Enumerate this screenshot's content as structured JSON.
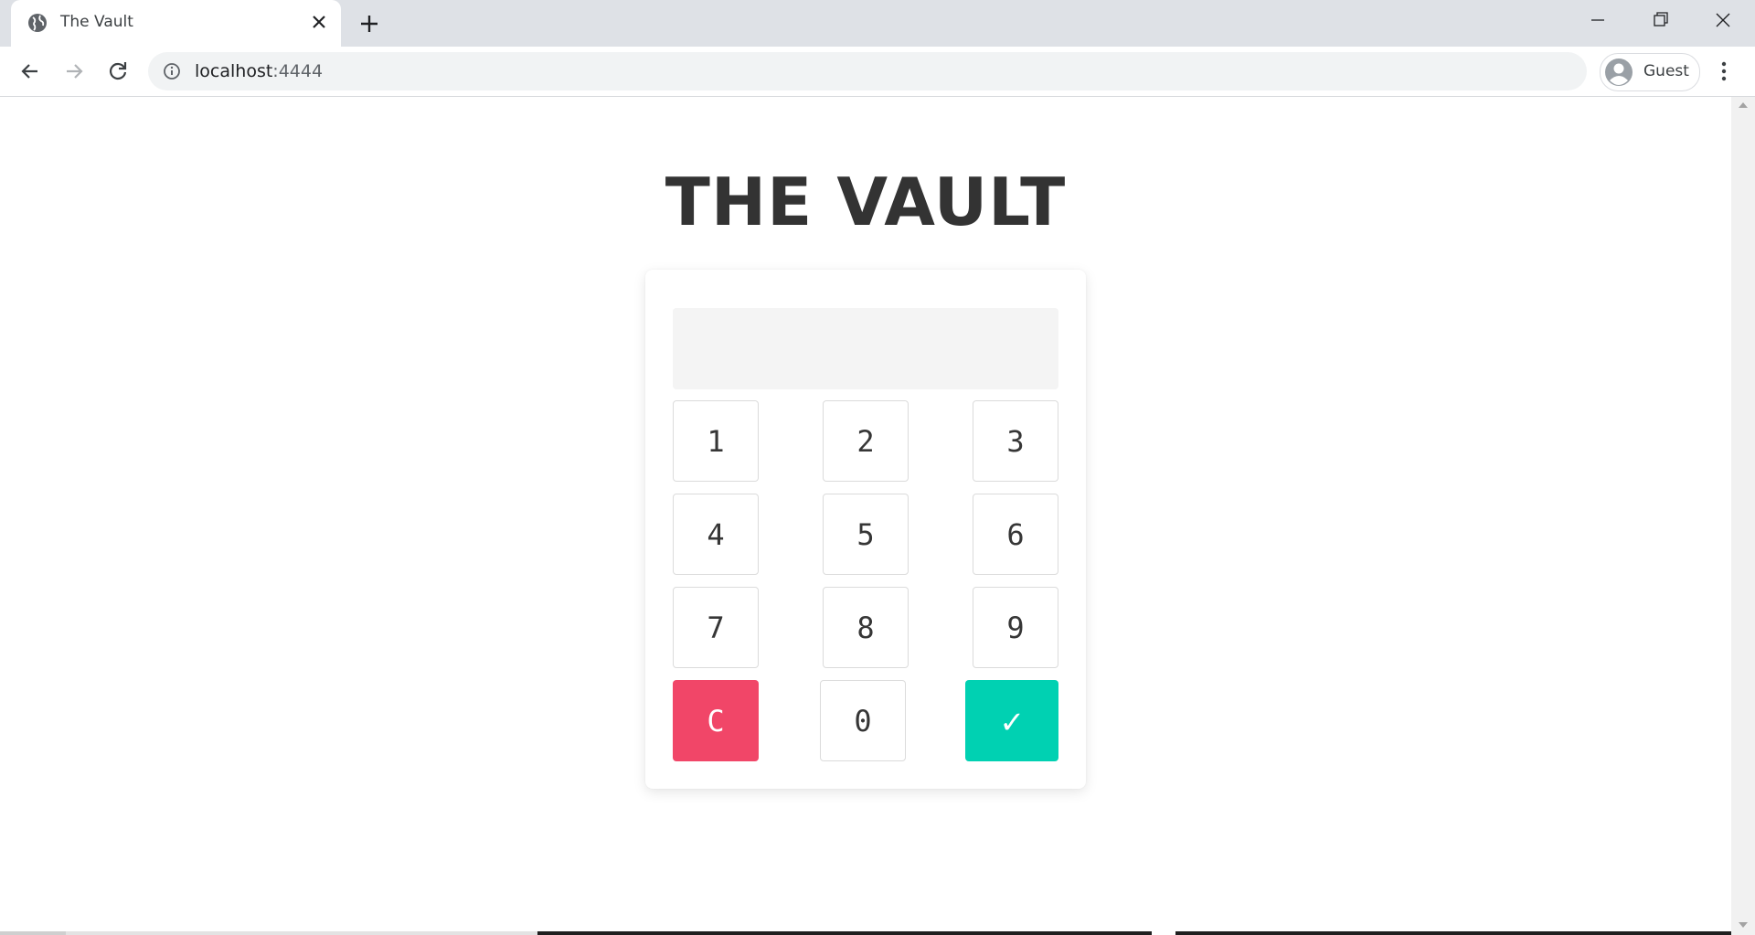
{
  "browser": {
    "tab_title": "The Vault",
    "url_host": "localhost",
    "url_port": ":4444",
    "profile_label": "Guest"
  },
  "page": {
    "title": "THE VAULT",
    "display_value": ""
  },
  "keypad": {
    "keys": [
      "1",
      "2",
      "3",
      "4",
      "5",
      "6",
      "7",
      "8",
      "9"
    ],
    "clear_label": "C",
    "zero_label": "0",
    "submit_label": "✓"
  },
  "colors": {
    "clear": "#f14668",
    "submit": "#00d1b2",
    "title": "#333333",
    "display_bg": "#f4f4f4"
  },
  "icons": {
    "tab_favicon": "globe-icon",
    "tab_close": "close-icon",
    "new_tab": "plus-icon",
    "back": "back-arrow-icon",
    "forward": "forward-arrow-icon",
    "reload": "reload-icon",
    "site_info": "info-icon",
    "profile": "avatar-icon",
    "menu": "kebab-menu-icon"
  }
}
